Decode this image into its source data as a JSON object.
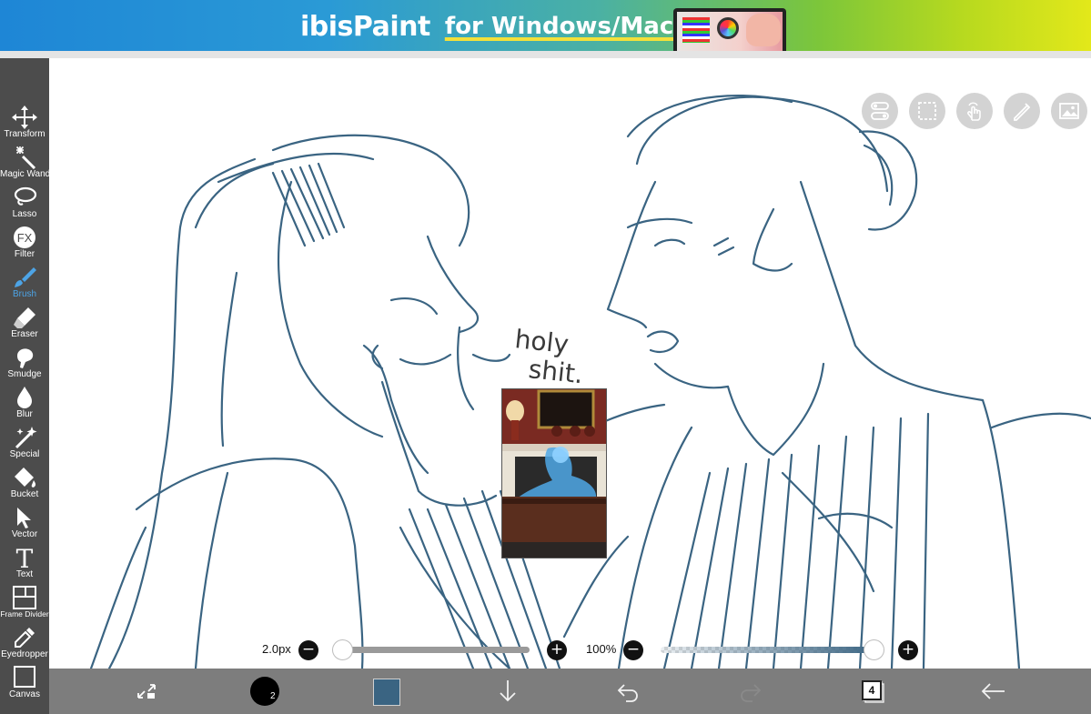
{
  "banner": {
    "logo": "ibisPaint",
    "tagline": "for Windows/Mac"
  },
  "tools": [
    {
      "label": "Transform",
      "icon": "transform-icon",
      "active": false
    },
    {
      "label": "Magic Wand",
      "icon": "magic-wand-icon",
      "active": false
    },
    {
      "label": "Lasso",
      "icon": "lasso-icon",
      "active": false
    },
    {
      "label": "Filter",
      "icon": "filter-fx-icon",
      "active": false
    },
    {
      "label": "Brush",
      "icon": "brush-icon",
      "active": true
    },
    {
      "label": "Eraser",
      "icon": "eraser-icon",
      "active": false
    },
    {
      "label": "Smudge",
      "icon": "smudge-icon",
      "active": false
    },
    {
      "label": "Blur",
      "icon": "blur-drop-icon",
      "active": false
    },
    {
      "label": "Special",
      "icon": "special-sparkle-icon",
      "active": false
    },
    {
      "label": "Bucket",
      "icon": "bucket-icon",
      "active": false
    },
    {
      "label": "Vector",
      "icon": "vector-arrow-icon",
      "active": false
    },
    {
      "label": "Text",
      "icon": "text-t-icon",
      "active": false
    },
    {
      "label": "Frame Divider",
      "icon": "frame-divider-icon",
      "active": false
    },
    {
      "label": "Eyedropper",
      "icon": "eyedropper-icon",
      "active": false
    },
    {
      "label": "Canvas",
      "icon": "canvas-icon",
      "active": false
    }
  ],
  "overlay_buttons": [
    "toggle-icon",
    "selection-icon",
    "touch-hand-icon",
    "ruler-pen-icon",
    "image-icon"
  ],
  "canvas": {
    "handwriting": [
      "holy",
      "shit."
    ]
  },
  "brush_settings": {
    "size_label": "2.0px",
    "size_fraction": 0.0,
    "opacity_label": "100%",
    "opacity_fraction": 1.0,
    "minus": "−",
    "plus": "+"
  },
  "bottom_bar": {
    "brush_number": "2",
    "color": "#3a6482",
    "layer_count": "4"
  },
  "colors": {
    "toolbar_bg": "#4c4c4c",
    "active_tool": "#4da4e6",
    "stroke": "#3a6482"
  }
}
